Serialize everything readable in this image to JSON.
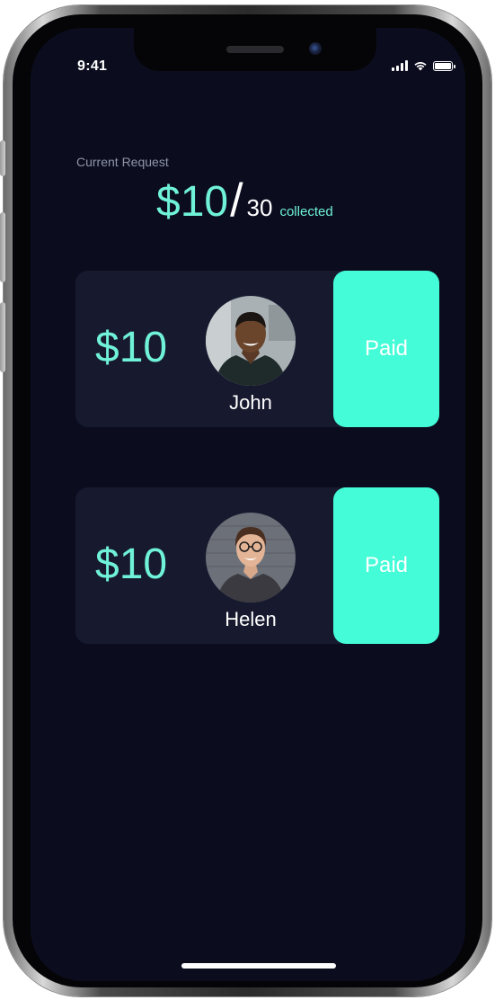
{
  "status_bar": {
    "time": "9:41",
    "icons": [
      "cellular-signal-icon",
      "wifi-icon",
      "battery-icon"
    ]
  },
  "request": {
    "label": "Current Request",
    "collected_amount": "$10",
    "slash": "/",
    "goal_amount": "30",
    "collected_label": "collected"
  },
  "payments": [
    {
      "amount": "$10",
      "name": "John",
      "status": "Paid"
    },
    {
      "amount": "$10",
      "name": "Helen",
      "status": "Paid"
    }
  ],
  "colors": {
    "background": "#0b0d1f",
    "card": "#171a2e",
    "accent": "#6ff2d8",
    "paid_button": "#44fcd8",
    "muted_text": "#8e93a8"
  }
}
